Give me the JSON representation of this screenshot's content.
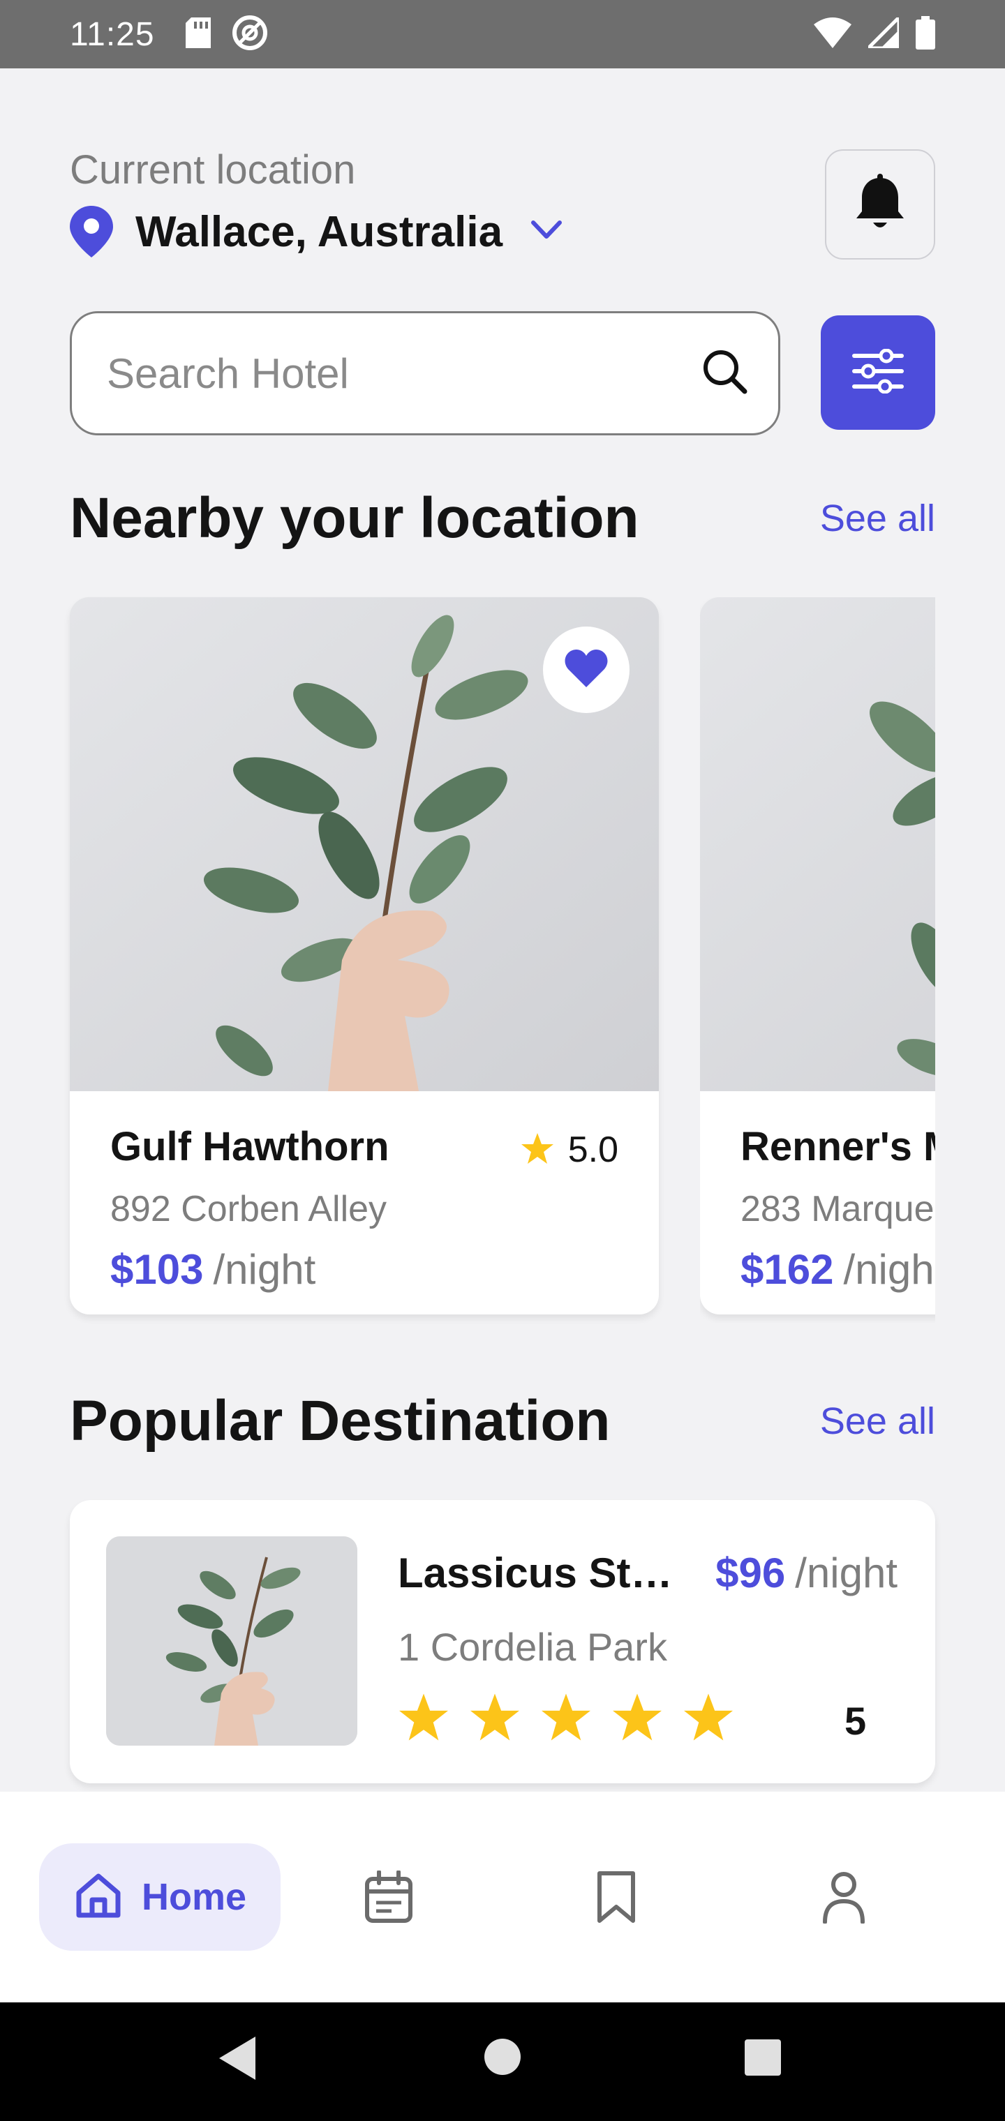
{
  "status_bar": {
    "time": "11:25"
  },
  "header": {
    "location_label": "Current location",
    "location_value": "Wallace, Australia"
  },
  "search": {
    "placeholder": "Search Hotel"
  },
  "nearby": {
    "title": "Nearby your location",
    "see_all": "See all",
    "hotels": [
      {
        "name": "Gulf Hawthorn",
        "address": "892 Corben Alley",
        "price": "$103",
        "unit": "/night",
        "rating": "5.0"
      },
      {
        "name": "Renner's M",
        "address": "283 Marque",
        "price": "$162",
        "unit": "/nigh"
      }
    ]
  },
  "popular": {
    "title": "Popular Destination",
    "see_all": "See all",
    "items": [
      {
        "name": "Lassicus Stit...",
        "price": "$96",
        "unit": "/night",
        "address": "1 Cordelia Park",
        "stars": 5,
        "rating": "5"
      }
    ]
  },
  "bottom_nav": {
    "items": [
      {
        "label": "Home",
        "icon": "home-icon",
        "active": true
      },
      {
        "icon": "calendar-icon"
      },
      {
        "icon": "bookmark-icon"
      },
      {
        "icon": "profile-icon"
      }
    ]
  },
  "colors": {
    "accent": "#4d4ddb",
    "star": "#fcc419",
    "background": "#f2f2f4",
    "status_bar": "#6e6e6e"
  }
}
